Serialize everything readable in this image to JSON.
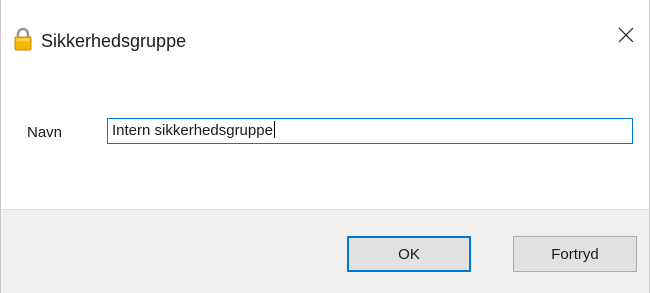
{
  "dialog": {
    "title": "Sikkerhedsgruppe",
    "title_icon": "padlock-icon",
    "close_icon": "close-icon"
  },
  "form": {
    "name_label": "Navn",
    "name_value": "Intern sikkerhedsgruppe"
  },
  "buttons": {
    "ok_label": "OK",
    "cancel_label": "Fortryd"
  },
  "colors": {
    "accent": "#0078d7",
    "footer_bg": "#f0f0f0",
    "button_bg": "#e1e1e1"
  }
}
